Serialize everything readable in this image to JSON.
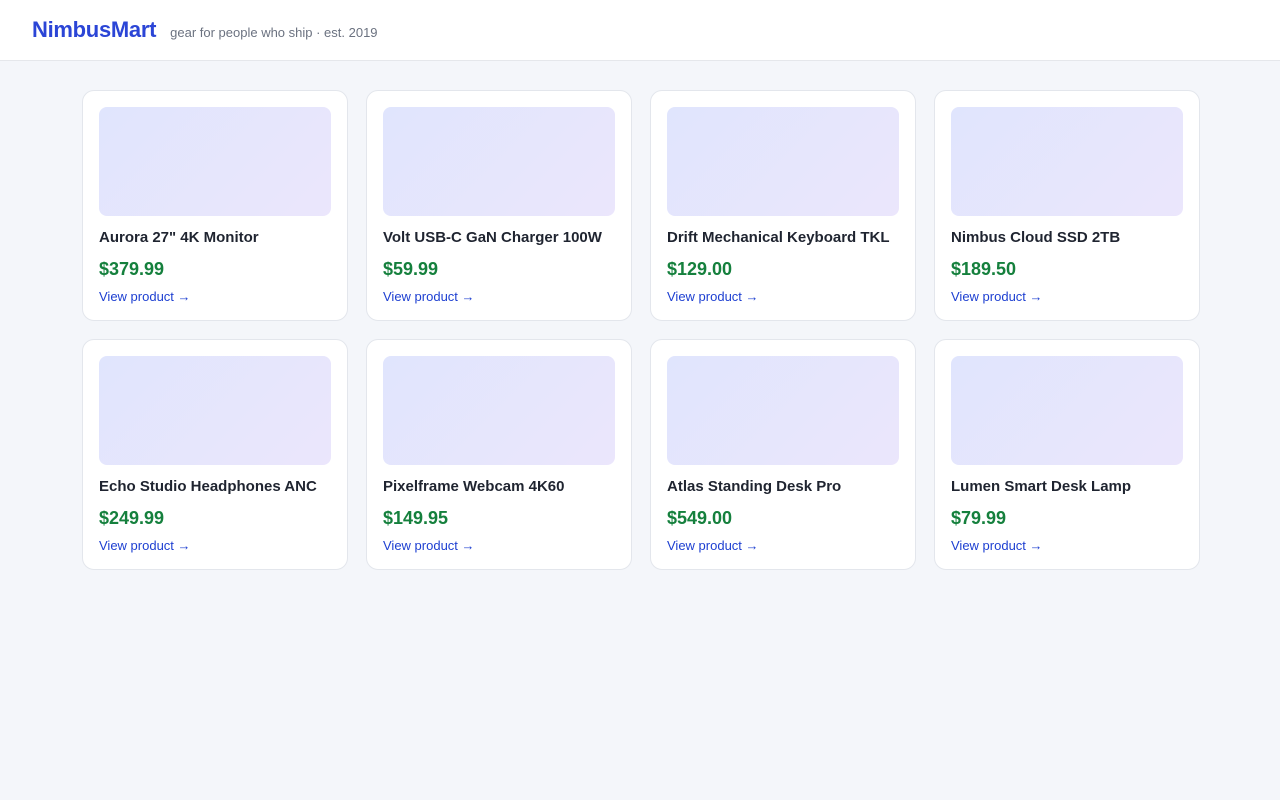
{
  "header": {
    "brand": "NimbusMart",
    "tagline": "gear for people who ship · est. 2019"
  },
  "products": [
    {
      "name": "Aurora 27\" 4K Monitor",
      "price": "$379.99",
      "link": "View product →"
    },
    {
      "name": "Volt USB-C GaN Charger 100W",
      "price": "$59.99",
      "link": "View product →"
    },
    {
      "name": "Drift Mechanical Keyboard TKL",
      "price": "$129.00",
      "link": "View product →"
    },
    {
      "name": "Nimbus Cloud SSD 2TB",
      "price": "$189.50",
      "link": "View product →"
    },
    {
      "name": "Echo Studio Headphones ANC",
      "price": "$249.99",
      "link": "View product →"
    },
    {
      "name": "Pixelframe Webcam 4K60",
      "price": "$149.95",
      "link": "View product →"
    },
    {
      "name": "Atlas Standing Desk Pro",
      "price": "$549.00",
      "link": "View product →"
    },
    {
      "name": "Lumen Smart Desk Lamp",
      "price": "$79.99",
      "link": "View product →"
    }
  ],
  "colors": {
    "brand": "#2b45d6",
    "price": "#15803d",
    "link": "#1d3fd1",
    "background": "#f4f6fa"
  }
}
